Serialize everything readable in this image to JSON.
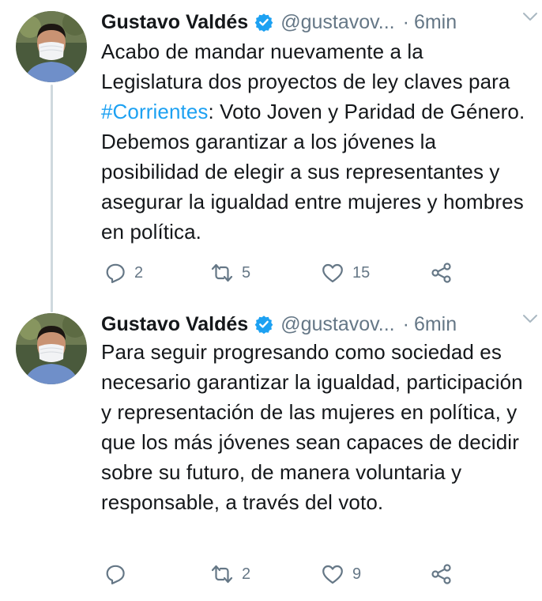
{
  "colors": {
    "accent": "#1da1f2",
    "verified": "#1da1f2",
    "text": "#14171a",
    "secondary": "#657786",
    "thread_line": "#cfd9de"
  },
  "tweets": [
    {
      "author": {
        "name": "Gustavo Valdés",
        "handle": "@gustavov...",
        "verified_icon": "verified-badge"
      },
      "separator": "·",
      "time": "6min",
      "body": {
        "before": "Acabo de mandar nuevamente a la Legislatura dos proyectos de ley claves para ",
        "hashtag": "#Corrientes",
        "after": ": Voto Joven y Paridad de Género. Debemos garantizar a los jóvenes la posibilidad de elegir a sus representantes y asegurar la igualdad entre mujeres y hombres en política."
      },
      "actions": {
        "replies": "2",
        "retweets": "5",
        "likes": "15"
      }
    },
    {
      "author": {
        "name": "Gustavo Valdés",
        "handle": "@gustavov...",
        "verified_icon": "verified-badge"
      },
      "separator": "·",
      "time": "6min",
      "body": {
        "text": "Para seguir progresando como sociedad es necesario garantizar la igualdad, participación y representación de las mujeres en política, y que los más jóvenes sean capaces de decidir sobre su futuro, de manera voluntaria y responsable, a través del voto."
      },
      "actions": {
        "replies": "",
        "retweets": "2",
        "likes": "9"
      }
    }
  ]
}
